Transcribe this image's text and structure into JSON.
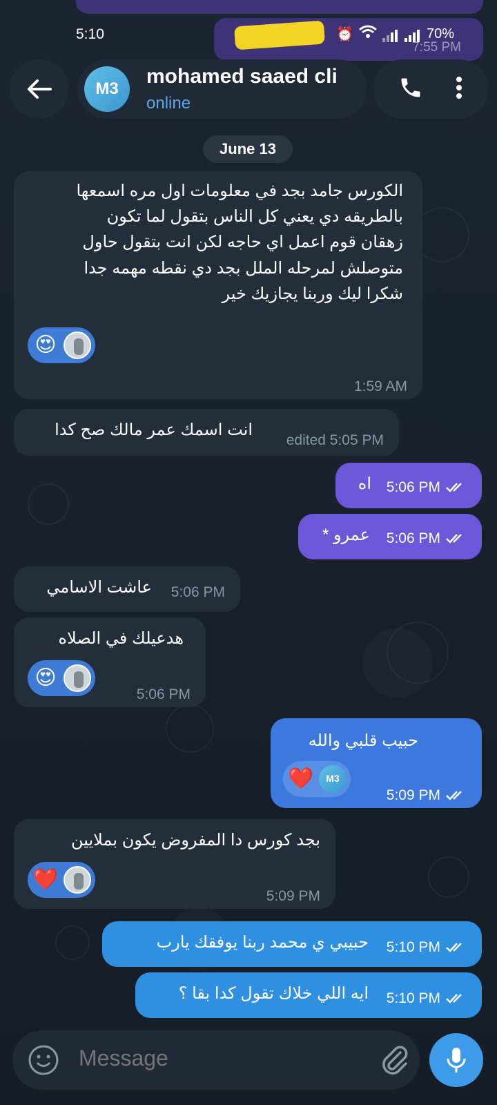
{
  "status_bar": {
    "time": "5:10",
    "battery": "70%"
  },
  "peek": {
    "time": "7:55 PM"
  },
  "header": {
    "avatar_initials": "M3",
    "name": "mohamed saaed cli",
    "status": "online"
  },
  "date_label": "June 13",
  "messages": [
    {
      "dir": "in",
      "text": "الكورس جامد بجد في معلومات اول مره اسمعها\nبالطريقه دي يعني كل الناس بتقول لما تكون\nزهقان قوم اعمل اي حاجه لكن انت بتقول حاول\nمتوصلش لمرحله الملل بجد دي نقطه مهمه جدا\nشكرا ليك وربنا يجازيك خير",
      "time": "1:59 AM",
      "reaction": "😍"
    },
    {
      "dir": "in",
      "text": "انت اسمك عمر مالك صح كدا",
      "time": "edited 5:05 PM"
    },
    {
      "dir": "out",
      "text": "اه",
      "time": "5:06 PM"
    },
    {
      "dir": "out",
      "text": "عمرو *",
      "time": "5:06 PM"
    },
    {
      "dir": "in",
      "text": "عاشت الاسامي",
      "time": "5:06 PM"
    },
    {
      "dir": "in",
      "text": "هدعيلك في الصلاه",
      "time": "5:06 PM",
      "reaction": "😍"
    },
    {
      "dir": "out",
      "text": "حبيب قلبي والله",
      "time": "5:09 PM",
      "reaction": "❤️"
    },
    {
      "dir": "in",
      "text": "بجد كورس دا المفروض يكون بملايين",
      "time": "5:09 PM",
      "reaction": "❤️"
    },
    {
      "dir": "out",
      "text": "حبيبي ي محمد ربنا يوفقك يارب",
      "time": "5:10 PM"
    },
    {
      "dir": "out",
      "text": "ايه اللي خلاك تقول كدا بقا ؟",
      "time": "5:10 PM"
    }
  ],
  "composer": {
    "placeholder": "Message"
  }
}
